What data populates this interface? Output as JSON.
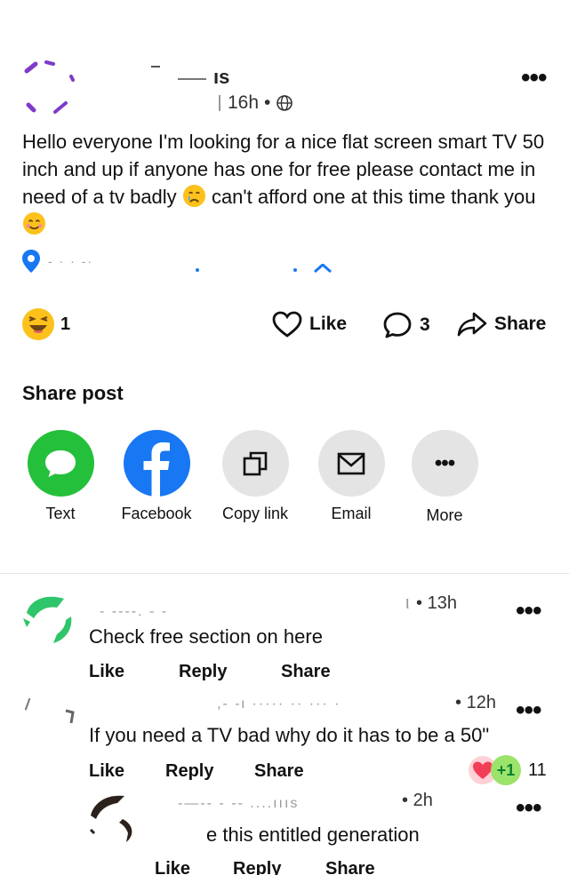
{
  "post": {
    "author_fragment": "ıs",
    "time": "16h",
    "text": "Hello everyone I'm looking for a nice flat screen smart TV 50 inch and up if anyone has one for free please contact me in need of a tv badly",
    "text_after_emoji": "can't afford one at this time thank you",
    "reaction_count": "1",
    "actions": {
      "like": "Like",
      "comment_count": "3",
      "share": "Share"
    },
    "colors": {
      "location_pin": "#1877f2",
      "avatar": "#7e3bc9"
    }
  },
  "share_post": {
    "title": "Share post",
    "items": [
      {
        "label": "Text",
        "icon": "chat-bubble-icon",
        "color": "#25c03b"
      },
      {
        "label": "Facebook",
        "icon": "facebook-icon",
        "color": "#1877f2"
      },
      {
        "label": "Copy link",
        "icon": "copy-link-icon",
        "color": "#e4e4e4"
      },
      {
        "label": "Email",
        "icon": "envelope-icon",
        "color": "#e4e4e4"
      },
      {
        "label": "More",
        "icon": "more-dots-icon",
        "color": "#e4e4e4"
      }
    ]
  },
  "comments": [
    {
      "time": "13h",
      "text": "Check free section on here",
      "actions": [
        "Like",
        "Reply",
        "Share"
      ]
    },
    {
      "time": "12h",
      "text": "If you need a TV bad why do it has to be a 50\"",
      "actions": [
        "Like",
        "Reply",
        "Share"
      ],
      "reaction_badge": "+1",
      "reaction_count": "11"
    },
    {
      "time": "2h",
      "text": "e this entitled generation",
      "actions": [
        "Like",
        "Reply",
        "Share"
      ]
    }
  ]
}
